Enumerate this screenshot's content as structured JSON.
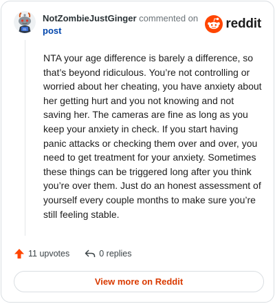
{
  "comment": {
    "author": "NotZombieJustGinger",
    "action_text": "commented on",
    "target_link": "post",
    "body": "NTA your age difference is barely a difference, so that’s beyond ridiculous. You’re not controlling or worried about her cheating, you have anxiety about her getting hurt and you not knowing and not saving her. The cameras are fine as long as you keep your anxiety in check. If you start having panic attacks or checking them over and over, you need to get treatment for your anxiety. Sometimes these things can be triggered long after you think you’re over them. Just do an honest assessment of yourself every couple months to make sure you’re still feeling stable.",
    "upvotes_label": "11 upvotes",
    "replies_label": "0 replies",
    "view_more_label": "View more on Reddit"
  },
  "brand": {
    "name": "reddit",
    "logo_icon": "reddit-snoo-icon",
    "accent_color": "#ff4500"
  },
  "icons": {
    "upvote": "upvote-arrow-icon",
    "reply": "reply-arrow-icon",
    "avatar": "user-avatar"
  }
}
